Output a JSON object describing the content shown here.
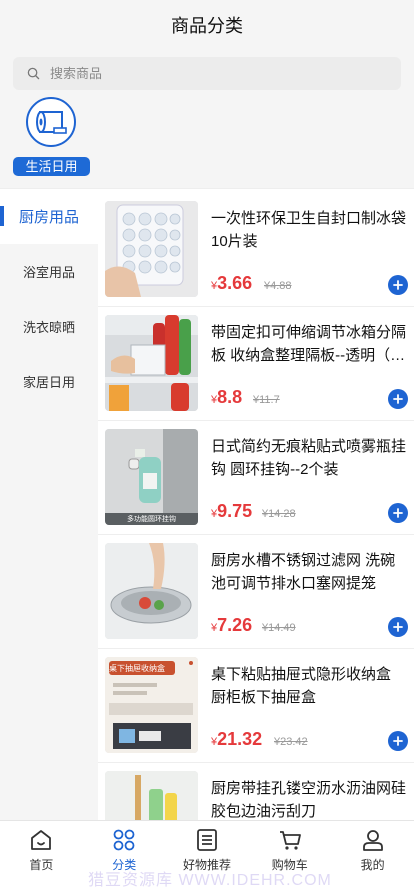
{
  "header": {
    "title": "商品分类"
  },
  "search": {
    "placeholder": "搜索商品"
  },
  "top_category": {
    "label": "生活日用",
    "icon": "tissue-roll-icon"
  },
  "sidebar": {
    "items": [
      {
        "label": "厨房用品",
        "active": true
      },
      {
        "label": "浴室用品",
        "active": false
      },
      {
        "label": "洗衣晾晒",
        "active": false
      },
      {
        "label": "家居日用",
        "active": false
      }
    ]
  },
  "currency": "¥",
  "products": [
    {
      "title": "一次性环保卫生自封口制冰袋10片装",
      "price": "3.66",
      "original_price": "4.88"
    },
    {
      "title": "带固定扣可伸缩调节冰箱分隔板 收纳盒整理隔板--透明（…",
      "price": "8.8",
      "original_price": "11.7"
    },
    {
      "title": "日式简约无痕粘贴式喷雾瓶挂钩 圆环挂钩--2个装",
      "price": "9.75",
      "original_price": "14.28",
      "image_caption": "多功能圆环挂钩"
    },
    {
      "title": "厨房水槽不锈钢过滤网 洗碗池可调节排水口塞网提笼",
      "price": "7.26",
      "original_price": "14.49"
    },
    {
      "title": "桌下粘贴抽屉式隐形收纳盒 厨柜板下抽屉盒",
      "price": "21.32",
      "original_price": "23.42",
      "image_caption": "桌下抽屉收纳盒"
    },
    {
      "title": "厨房带挂孔镂空沥水沥油网硅胶包边油污刮刀",
      "price": "",
      "original_price": ""
    }
  ],
  "tabbar": {
    "items": [
      {
        "label": "首页",
        "active": false
      },
      {
        "label": "分类",
        "active": true
      },
      {
        "label": "好物推荐",
        "active": false
      },
      {
        "label": "购物车",
        "active": false
      },
      {
        "label": "我的",
        "active": false
      }
    ]
  },
  "watermark": "猎豆资源库 WWW.IDEHR.COM",
  "colors": {
    "accent": "#1e64d2",
    "price": "#e5393b"
  }
}
